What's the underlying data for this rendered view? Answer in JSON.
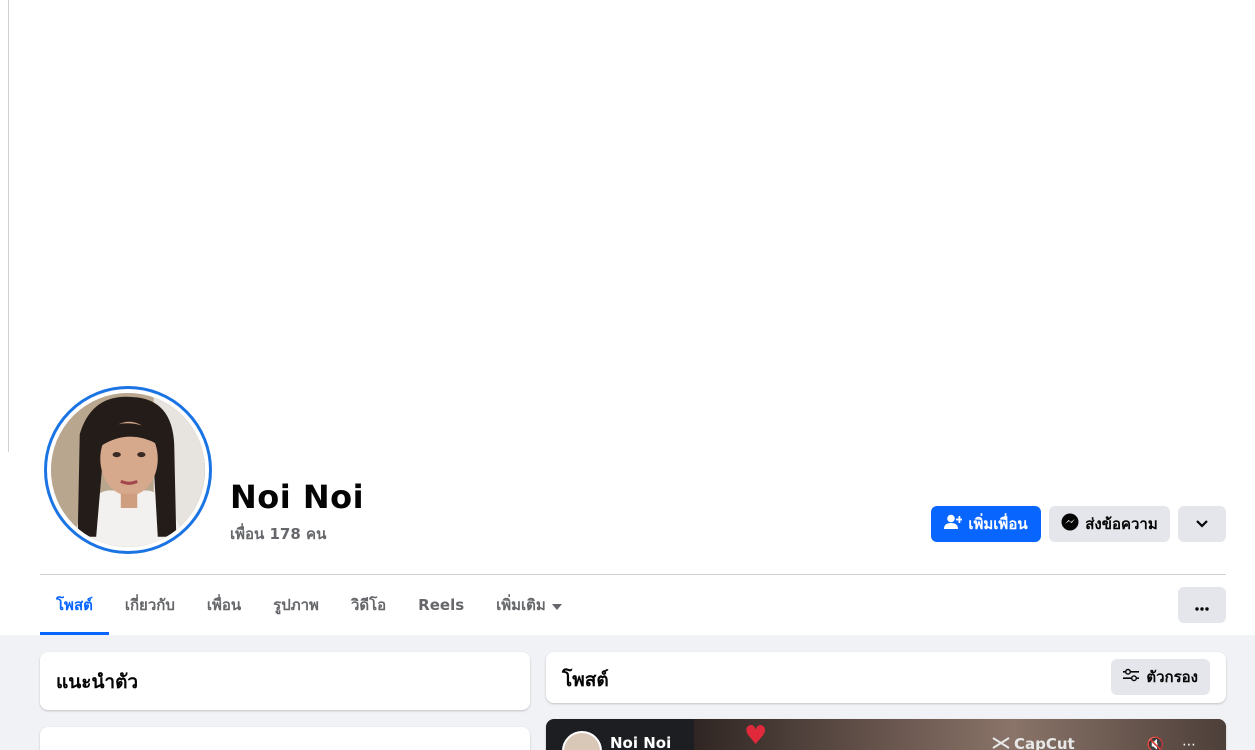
{
  "profile": {
    "name": "Noi Noi",
    "friends": "เพื่อน 178 คน"
  },
  "actions": {
    "add_friend": "เพิ่มเพื่อน",
    "message": "ส่งข้อความ"
  },
  "tabs": [
    {
      "label": "โพสต์",
      "active": true
    },
    {
      "label": "เกี่ยวกับ"
    },
    {
      "label": "เพื่อน"
    },
    {
      "label": "รูปภาพ"
    },
    {
      "label": "วิดีโอ"
    },
    {
      "label": "Reels"
    },
    {
      "label": "เพิ่มเติม"
    }
  ],
  "intro": {
    "title": "แนะนำตัว"
  },
  "posts": {
    "title": "โพสต์",
    "filter_label": "ตัวกรอง",
    "first_post": {
      "author": "Noi Noi",
      "watermark": "CapCut"
    }
  },
  "colors": {
    "accent": "#0866ff",
    "ring": "#1b74e4",
    "secondary_bg": "#e4e6eb",
    "feed_bg": "#f0f2f5"
  }
}
